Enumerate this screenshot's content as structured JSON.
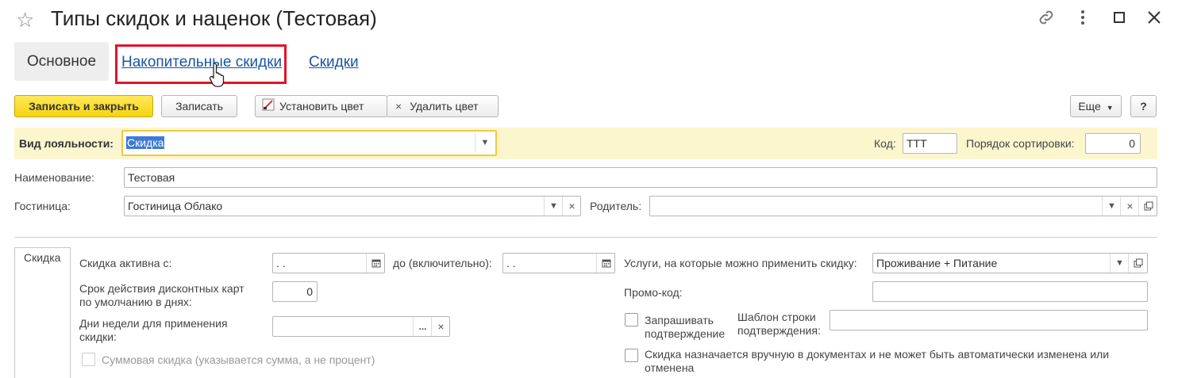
{
  "window": {
    "title": "Типы скидок и наценок (Тестовая)",
    "icons": [
      "star-icon",
      "link-icon",
      "more-vertical-icon",
      "maximize-icon",
      "close-icon"
    ]
  },
  "tabs": [
    {
      "label": "Основное"
    },
    {
      "label": "Накопительные скидки"
    },
    {
      "label": "Скидки"
    }
  ],
  "toolbar": {
    "save_close": "Записать и закрыть",
    "save": "Записать",
    "set_color": "Установить цвет",
    "remove_color": "Удалить цвет",
    "more": "Еще",
    "help": "?"
  },
  "form": {
    "loyalty_label": "Вид лояльности:",
    "loyalty_value": "Скидка",
    "code_label": "Код:",
    "code_value": "ТТТ",
    "sort_label": "Порядок сортировки:",
    "sort_value": "0",
    "name_label": "Наименование:",
    "name_value": "Тестовая",
    "hotel_label": "Гостиница:",
    "hotel_value": "Гостиница Облако",
    "parent_label": "Родитель:",
    "parent_value": ""
  },
  "section": {
    "tab_label": "Скидка",
    "active_from_label": "Скидка активна с:",
    "active_from_value": " .  .",
    "to_label": "до (включительно):",
    "to_value": " .  .",
    "card_term_label_1": "Срок действия дисконтных карт",
    "card_term_label_2": "по умолчанию в днях:",
    "card_term_value": "0",
    "weekdays_label_1": "Дни недели для применения",
    "weekdays_label_2": "скидки:",
    "weekdays_value": "",
    "sum_discount_label": "Суммовая скидка (указывается сумма, а не процент)",
    "services_label": "Услуги, на которые можно применить скидку:",
    "services_value": "Проживание + Питание",
    "promo_label": "Промо-код:",
    "promo_value": "",
    "ask_confirm_label_1": "Запрашивать",
    "ask_confirm_label_2": "подтверждение",
    "template_label_1": "Шаблон строки",
    "template_label_2": "подтверждения:",
    "template_value": "",
    "manual_label_1": "Скидка назначается вручную в документах и не может быть автоматически изменена или",
    "manual_label_2": "отменена"
  },
  "colors": {
    "accent_yellow": "#f5d40f",
    "band_yellow": "#fcf6cf",
    "link_blue": "#1a55a3",
    "highlight_red": "#e1142a",
    "selection_blue": "#3d7ad6"
  }
}
